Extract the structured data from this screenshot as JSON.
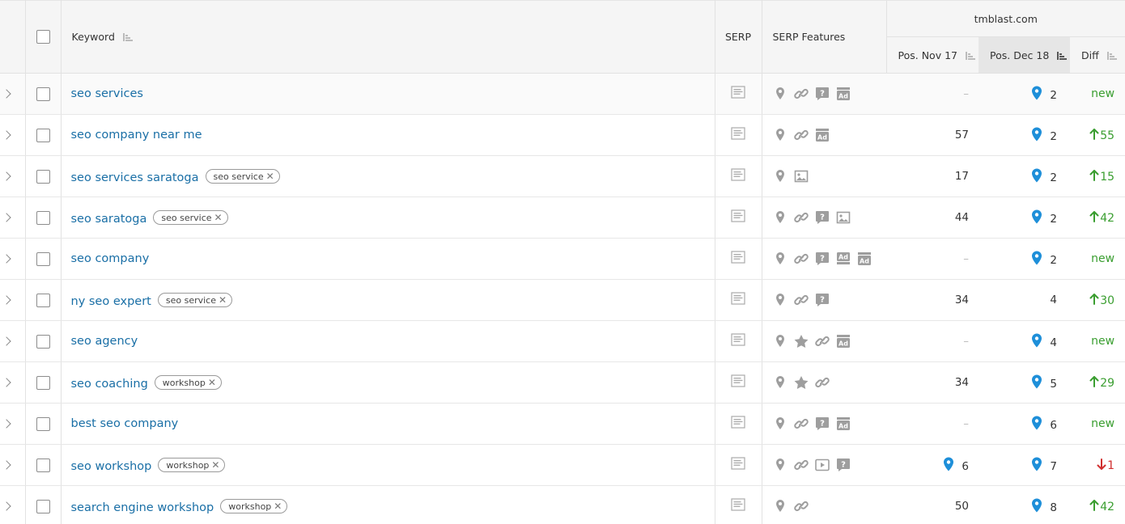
{
  "header": {
    "keyword_label": "Keyword",
    "serp_label": "SERP",
    "serp_features_label": "SERP Features",
    "domain": "tmblast.com",
    "pos_nov_label": "Pos. Nov 17",
    "pos_dec_label": "Pos. Dec 18",
    "diff_label": "Diff"
  },
  "rows": [
    {
      "keyword": "seo services",
      "tag": "",
      "features": [
        "map-pin-icon",
        "link-icon",
        "question-icon",
        "ad-icon"
      ],
      "nov": "–",
      "nov_pin": false,
      "dec": "2",
      "dec_pin": true,
      "diff": "new",
      "diff_type": "new"
    },
    {
      "keyword": "seo company near me",
      "tag": "",
      "features": [
        "map-pin-icon",
        "link-icon",
        "ad-icon"
      ],
      "nov": "57",
      "nov_pin": false,
      "dec": "2",
      "dec_pin": true,
      "diff": "55",
      "diff_type": "up"
    },
    {
      "keyword": "seo services saratoga",
      "tag": "seo service",
      "features": [
        "map-pin-icon",
        "image-icon"
      ],
      "nov": "17",
      "nov_pin": false,
      "dec": "2",
      "dec_pin": true,
      "diff": "15",
      "diff_type": "up"
    },
    {
      "keyword": "seo saratoga",
      "tag": "seo service",
      "features": [
        "map-pin-icon",
        "link-icon",
        "question-icon",
        "image-icon"
      ],
      "nov": "44",
      "nov_pin": false,
      "dec": "2",
      "dec_pin": true,
      "diff": "42",
      "diff_type": "up"
    },
    {
      "keyword": "seo company",
      "tag": "",
      "features": [
        "map-pin-icon",
        "link-icon",
        "question-icon",
        "ad-top-icon",
        "ad-icon"
      ],
      "nov": "–",
      "nov_pin": false,
      "dec": "2",
      "dec_pin": true,
      "diff": "new",
      "diff_type": "new"
    },
    {
      "keyword": "ny seo expert",
      "tag": "seo service",
      "features": [
        "map-pin-icon",
        "link-icon",
        "question-icon"
      ],
      "nov": "34",
      "nov_pin": false,
      "dec": "4",
      "dec_pin": false,
      "diff": "30",
      "diff_type": "up"
    },
    {
      "keyword": "seo agency",
      "tag": "",
      "features": [
        "map-pin-icon",
        "star-icon",
        "link-icon",
        "ad-icon"
      ],
      "nov": "–",
      "nov_pin": false,
      "dec": "4",
      "dec_pin": true,
      "diff": "new",
      "diff_type": "new"
    },
    {
      "keyword": "seo coaching",
      "tag": "workshop",
      "features": [
        "map-pin-icon",
        "star-icon",
        "link-icon"
      ],
      "nov": "34",
      "nov_pin": false,
      "dec": "5",
      "dec_pin": true,
      "diff": "29",
      "diff_type": "up"
    },
    {
      "keyword": "best seo company",
      "tag": "",
      "features": [
        "map-pin-icon",
        "link-icon",
        "question-icon",
        "ad-icon"
      ],
      "nov": "–",
      "nov_pin": false,
      "dec": "6",
      "dec_pin": true,
      "diff": "new",
      "diff_type": "new"
    },
    {
      "keyword": "seo workshop",
      "tag": "workshop",
      "features": [
        "map-pin-icon",
        "link-icon",
        "video-icon",
        "question-icon"
      ],
      "nov": "6",
      "nov_pin": true,
      "dec": "7",
      "dec_pin": true,
      "diff": "1",
      "diff_type": "down"
    },
    {
      "keyword": "search engine workshop",
      "tag": "workshop",
      "features": [
        "map-pin-icon",
        "link-icon"
      ],
      "nov": "50",
      "nov_pin": false,
      "dec": "8",
      "dec_pin": true,
      "diff": "42",
      "diff_type": "up"
    }
  ],
  "colors": {
    "link": "#1a6fa6",
    "up": "#3a9e30",
    "down": "#d12f2f",
    "pin": "#1e8fd9",
    "icon": "#9e9e9e"
  }
}
